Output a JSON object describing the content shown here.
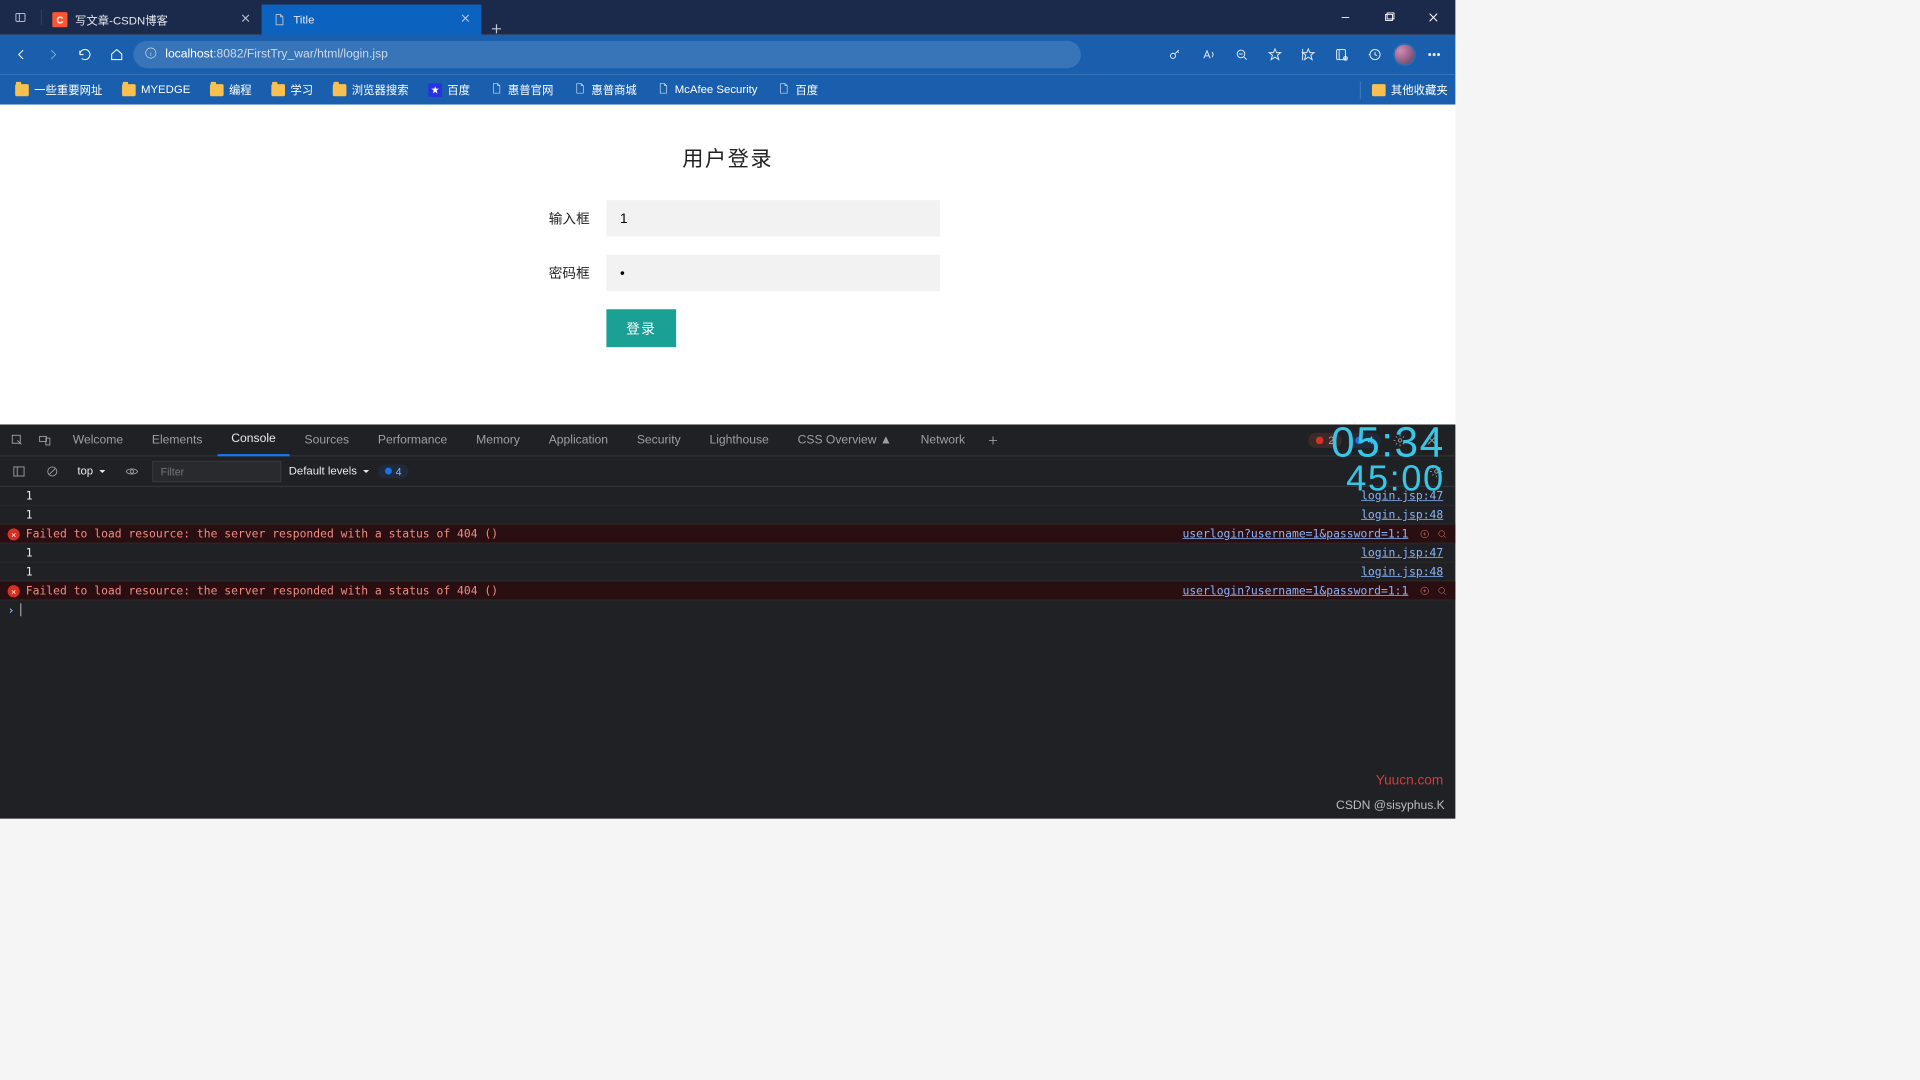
{
  "browser": {
    "tabs": [
      {
        "title": "写文章-CSDN博客",
        "favicon": "csdn",
        "active": false
      },
      {
        "title": "Title",
        "favicon": "page",
        "active": true
      }
    ],
    "url_host": "localhost",
    "url_rest": ":8082/FirstTry_war/html/login.jsp"
  },
  "bookmarks": {
    "items": [
      {
        "label": "一些重要网址",
        "icon": "folder"
      },
      {
        "label": "MYEDGE",
        "icon": "folder"
      },
      {
        "label": "编程",
        "icon": "folder"
      },
      {
        "label": "学习",
        "icon": "folder"
      },
      {
        "label": "浏览器搜索",
        "icon": "folder"
      },
      {
        "label": "百度",
        "icon": "baidu"
      },
      {
        "label": "惠普官网",
        "icon": "page"
      },
      {
        "label": "惠普商城",
        "icon": "page"
      },
      {
        "label": "McAfee Security",
        "icon": "page"
      },
      {
        "label": "百度",
        "icon": "page"
      }
    ],
    "overflow": "其他收藏夹"
  },
  "page": {
    "title": "用户登录",
    "input_label": "输入框",
    "input_value": "1",
    "password_label": "密码框",
    "password_value": "1",
    "login_button": "登录"
  },
  "devtools": {
    "tabs": [
      "Welcome",
      "Elements",
      "Console",
      "Sources",
      "Performance",
      "Memory",
      "Application",
      "Security",
      "Lighthouse",
      "CSS Overview ▲",
      "Network"
    ],
    "active_tab": "Console",
    "error_count": "2",
    "info_count": "4",
    "context": "top",
    "filter_placeholder": "Filter",
    "levels_label": "Default levels",
    "issues_count": "4",
    "rows": [
      {
        "type": "log",
        "msg": "1",
        "src": "login.jsp:47"
      },
      {
        "type": "log",
        "msg": "1",
        "src": "login.jsp:48"
      },
      {
        "type": "err",
        "msg": "Failed to load resource: the server responded with a status of 404 ()",
        "src": "userlogin?username=1&password=1:1"
      },
      {
        "type": "log",
        "msg": "1",
        "src": "login.jsp:47"
      },
      {
        "type": "log",
        "msg": "1",
        "src": "login.jsp:48"
      },
      {
        "type": "err",
        "msg": "Failed to load resource: the server responded with a status of 404 ()",
        "src": "userlogin?username=1&password=1:1"
      }
    ]
  },
  "clock": {
    "line1": "05:34",
    "line2": "45:00"
  },
  "watermarks": {
    "w1": "Yuucn.com",
    "w2": "CSDN @sisyphus.K"
  }
}
